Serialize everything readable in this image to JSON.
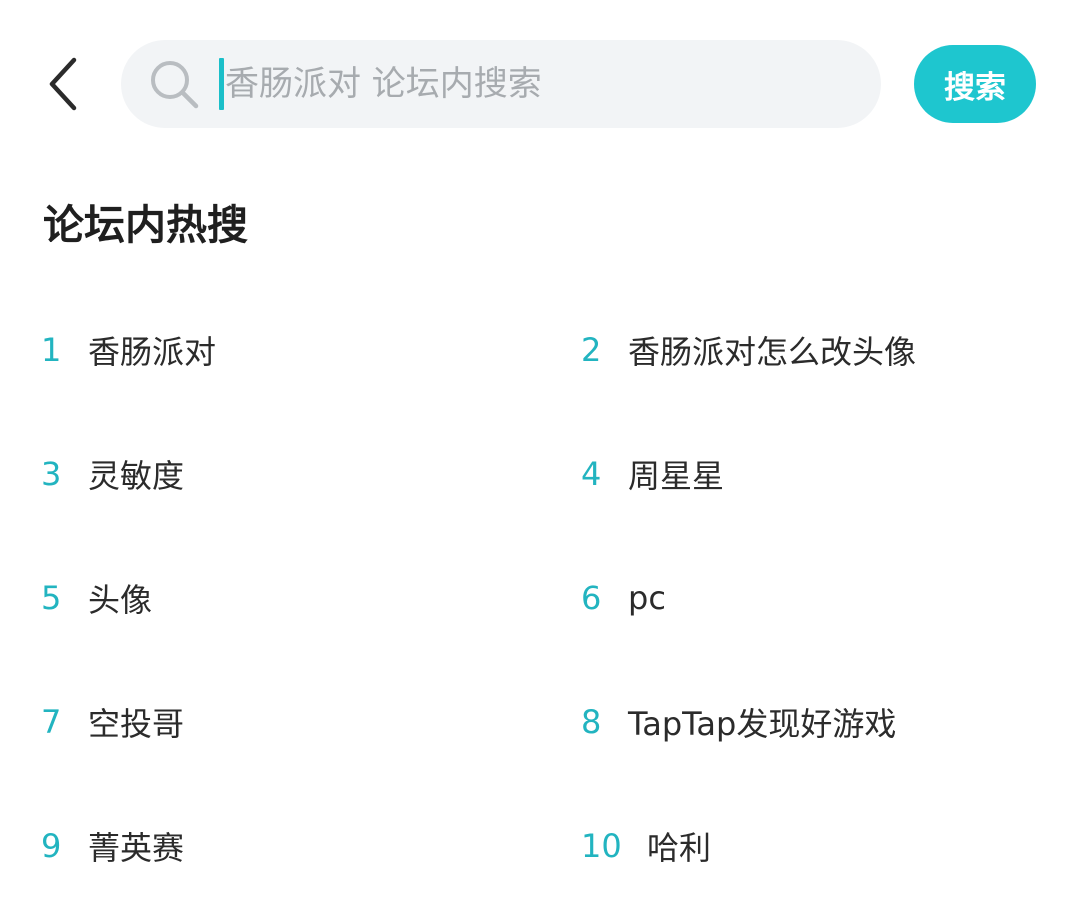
{
  "colors": {
    "accent": "#1ec6cf",
    "rank_number": "#22b4c0",
    "search_box_bg": "#f2f4f6",
    "placeholder": "#a7abaf"
  },
  "header": {
    "back_icon": "chevron-left-icon",
    "search": {
      "icon": "search-icon",
      "placeholder": "香肠派对 论坛内搜索",
      "value": ""
    },
    "search_button_label": "搜索"
  },
  "section": {
    "title": "论坛内热搜"
  },
  "hot_searches": [
    {
      "rank": "1",
      "term": "香肠派对"
    },
    {
      "rank": "2",
      "term": "香肠派对怎么改头像"
    },
    {
      "rank": "3",
      "term": "灵敏度"
    },
    {
      "rank": "4",
      "term": "周星星"
    },
    {
      "rank": "5",
      "term": "头像"
    },
    {
      "rank": "6",
      "term": "pc"
    },
    {
      "rank": "7",
      "term": "空投哥"
    },
    {
      "rank": "8",
      "term": "TapTap发现好游戏"
    },
    {
      "rank": "9",
      "term": "菁英赛"
    },
    {
      "rank": "10",
      "term": "哈利"
    }
  ]
}
